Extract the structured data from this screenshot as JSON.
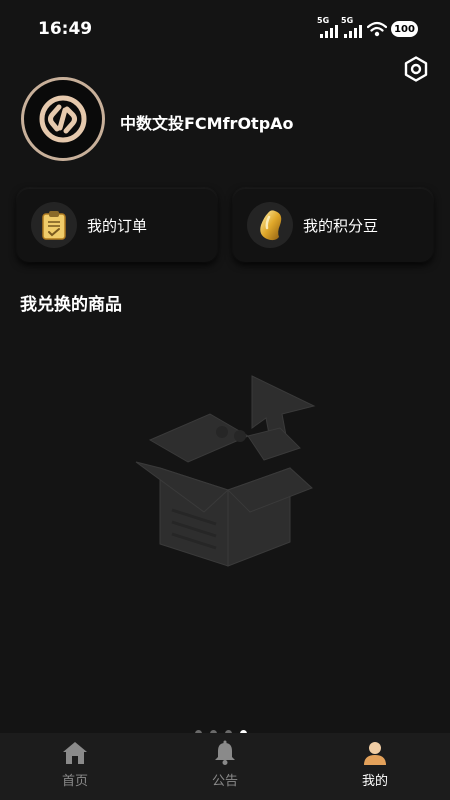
{
  "status_bar": {
    "time": "16:49",
    "signal1_label": "5G",
    "signal2_label": "5G",
    "battery": "100"
  },
  "profile": {
    "username": "中数文投FCMfrOtpAo",
    "avatar_icon": "brand-logo-icon"
  },
  "header": {
    "settings_icon": "settings-icon"
  },
  "quick_actions": [
    {
      "label": "我的订单",
      "icon": "clipboard-icon"
    },
    {
      "label": "我的积分豆",
      "icon": "bean-icon"
    }
  ],
  "section": {
    "title": "我兑换的商品"
  },
  "empty_state": {
    "icon": "empty-box-icon"
  },
  "pager": {
    "count": 4,
    "active_index": 3
  },
  "bottom_nav": {
    "items": [
      {
        "label": "首页",
        "icon": "home-icon"
      },
      {
        "label": "公告",
        "icon": "bell-icon"
      },
      {
        "label": "我的",
        "icon": "user-icon",
        "active": true
      }
    ]
  },
  "colors": {
    "background": "#141414",
    "accent_gold": "#e3b35c",
    "avatar_ring": "#c8b09a",
    "nav_bg": "#1c1c1c"
  }
}
